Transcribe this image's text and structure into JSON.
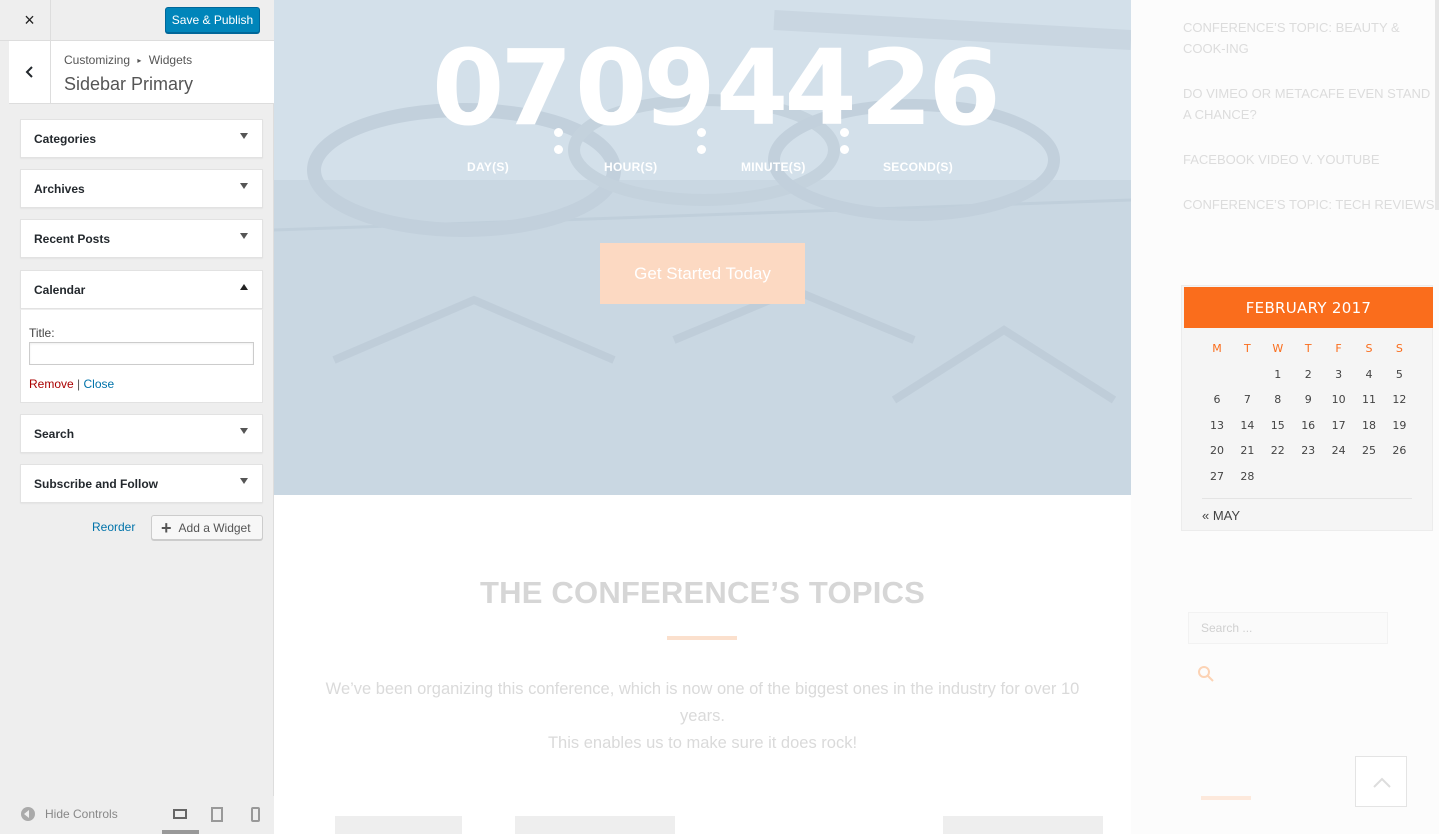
{
  "customizer": {
    "save_label": "Save & Publish",
    "close_icon": "×",
    "breadcrumb": {
      "root": "Customizing",
      "sep": "▸",
      "parent": "Widgets"
    },
    "section_title": "Sidebar Primary",
    "widgets": [
      {
        "title": "Categories",
        "expanded": false
      },
      {
        "title": "Archives",
        "expanded": false
      },
      {
        "title": "Recent Posts",
        "expanded": false
      },
      {
        "title": "Calendar",
        "expanded": true
      },
      {
        "title": "Search",
        "expanded": false
      },
      {
        "title": "Subscribe and Follow",
        "expanded": false
      }
    ],
    "calendar_form": {
      "title_label": "Title:",
      "title_value": "",
      "remove_label": "Remove",
      "separator": "|",
      "close_label": "Close"
    },
    "reorder_label": "Reorder",
    "add_widget_label": "Add a Widget",
    "hide_controls_label": "Hide Controls",
    "accent_color": "#0085ba"
  },
  "preview": {
    "countdown": {
      "days": "07",
      "hours": "09",
      "minutes": "44",
      "seconds": "26",
      "days_label": "DAY(S)",
      "hours_label": "HOUR(S)",
      "minutes_label": "MINUTE(S)",
      "seconds_label": "SECOND(S)"
    },
    "cta_label": "Get Started Today",
    "topics_title": "THE CONFERENCE’S TOPICS",
    "topics_desc_line1": "We’ve been organizing this conference, which is now one of the biggest ones in the industry for over 10 years.",
    "topics_desc_line2": "This enables us to make sure it does rock!",
    "brand_color": "#fa6d1c"
  },
  "sidebar": {
    "recent_posts": [
      "CONFERENCE’S TOPIC: BEAUTY & COOK-ING",
      "DO VIMEO OR METACAFE EVEN STAND A CHANCE?",
      "FACEBOOK VIDEO V. YOUTUBE",
      "CONFERENCE’S TOPIC: TECH REVIEWS"
    ],
    "calendar": {
      "caption": "FEBRUARY 2017",
      "weekdays": [
        "M",
        "T",
        "W",
        "T",
        "F",
        "S",
        "S"
      ],
      "weeks": [
        [
          "",
          "",
          "1",
          "2",
          "3",
          "4",
          "5"
        ],
        [
          "6",
          "7",
          "8",
          "9",
          "10",
          "11",
          "12"
        ],
        [
          "13",
          "14",
          "15",
          "16",
          "17",
          "18",
          "19"
        ],
        [
          "20",
          "21",
          "22",
          "23",
          "24",
          "25",
          "26"
        ],
        [
          "27",
          "28",
          "",
          "",
          "",
          "",
          ""
        ]
      ],
      "prev_link": "« MAY"
    },
    "search_placeholder": "Search ..."
  }
}
